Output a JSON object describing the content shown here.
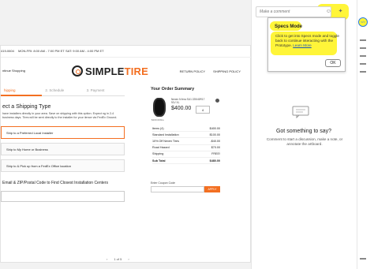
{
  "artboard": {
    "topbar": {
      "phone": "419-0604",
      "hours1": "MON-FRI: 8:00 AM - 7:00 PM ET",
      "hours2": "SAT: 9:00 AM - 4:00 PM ET"
    },
    "continue_label": "ntinue Shopping",
    "logo": {
      "simple": "SIMPLE",
      "tire": "TIRE"
    },
    "header_links": [
      "RETURN POLICY",
      "SHIPPING POLICY"
    ],
    "steps": [
      "hipping",
      "2. Schedule",
      "3. Payment"
    ],
    "section_title": "ect a Shipping Type",
    "section_desc": "have installers directly in your area. Save on shipping with this option. Expect ng in 2-4 business days. Tires will be sent directly to the installer for your iience via FedEx Ground.",
    "options": [
      "Ship to a Preferred Local Installer",
      "Ship to My Home or Business",
      "Ship to & Pick up from a FedEx Office location"
    ],
    "zip_label": "Email & ZIP/Postal Code to Find Closest Installation Centers",
    "pager": {
      "text": "1 of 5"
    },
    "summary": {
      "title": "Your Order Summary",
      "product_lines": [
        "Nexen N fera SU1 225/40R17",
        "91V XL"
      ],
      "price": "$400.00",
      "qty": "4",
      "tire_caption": "$100.00/tire",
      "lines": [
        {
          "label": "Items (4)",
          "value": "$400.00"
        },
        {
          "label": "Standard Installation",
          "value": "$100.00"
        },
        {
          "label": "10% Off Nexen Tires",
          "value": "-$40.00"
        },
        {
          "label": "Road Hazard",
          "value": "$70.00"
        },
        {
          "label": "Shipping",
          "value": "FREE!"
        },
        {
          "label": "Sub Total",
          "value": "$480.00"
        }
      ],
      "coupon_label": "Enter Coupon Code",
      "coupon_button": "APPLY"
    }
  },
  "comments_panel": {
    "input_placeholder": "Make a comment",
    "empty_title": "Got something to say?",
    "empty_desc": "Comment to start a discussion, make a note, or annotate the artboard."
  },
  "popup": {
    "title": "Specs Mode",
    "body_pre": "Click to get into Specs mode and toggle back to continue interacting with the Prototype. ",
    "link": "Learn More",
    "ok_label": "OK"
  },
  "strip": {
    "badge": "</>"
  },
  "colors": {
    "accent": "#f36f21",
    "highlight": "#fff428",
    "link": "#1a56b8"
  }
}
